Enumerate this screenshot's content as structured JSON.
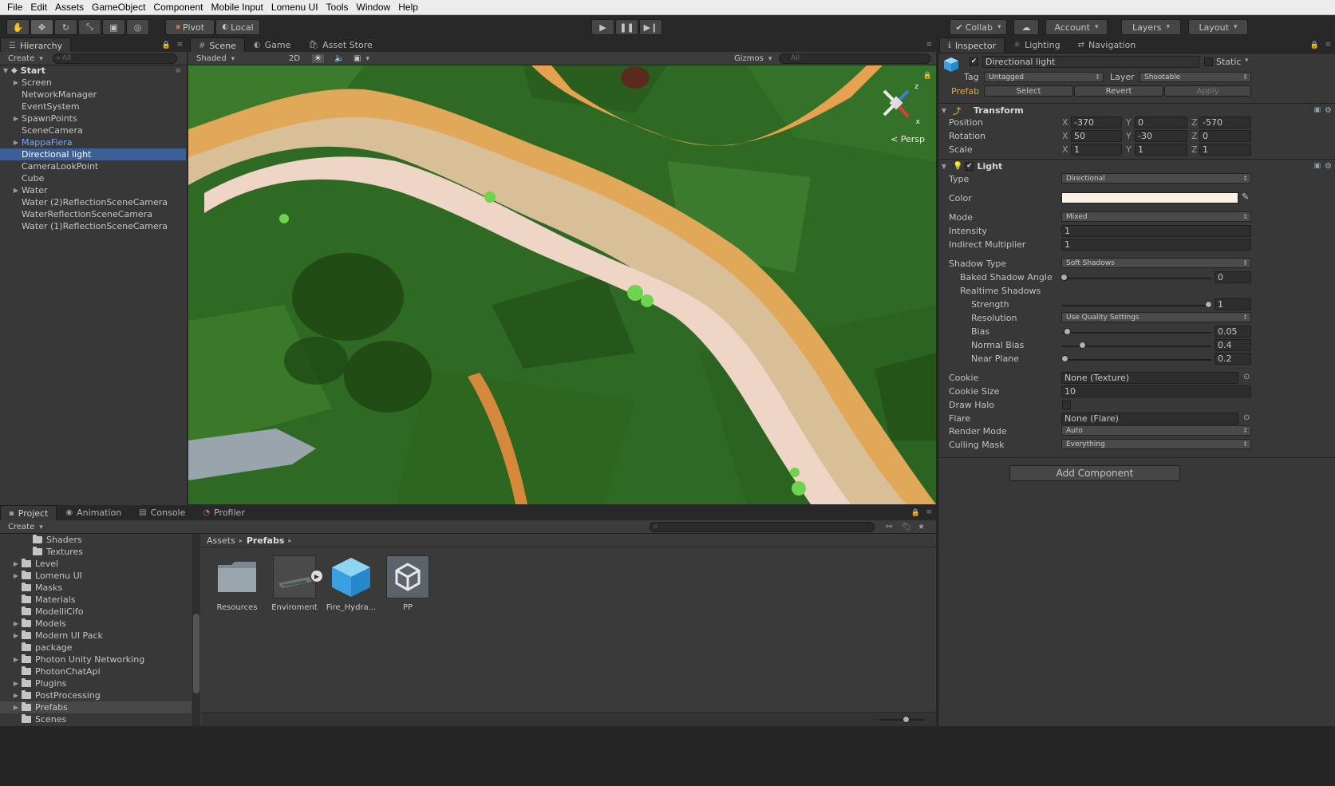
{
  "menu": [
    "File",
    "Edit",
    "Assets",
    "GameObject",
    "Component",
    "Mobile Input",
    "Lomenu UI",
    "Tools",
    "Window",
    "Help"
  ],
  "toolbar": {
    "pivot": "Pivot",
    "local": "Local",
    "collab": "Collab",
    "account": "Account",
    "layers": "Layers",
    "layout": "Layout"
  },
  "hierarchy": {
    "tab": "Hierarchy",
    "create": "Create",
    "search_placeholder": "All",
    "scene": "Start",
    "items": [
      "Screen",
      "NetworkManager",
      "EventSystem",
      "SpawnPoints",
      "SceneCamera",
      "MappaFiera",
      "Directional light",
      "CameraLookPoint",
      "Cube",
      "Water",
      "Water (2)ReflectionSceneCamera",
      "WaterReflectionSceneCamera",
      "Water (1)ReflectionSceneCamera"
    ],
    "selected": "Directional light"
  },
  "scene": {
    "tabs": [
      "Scene",
      "Game",
      "Asset Store"
    ],
    "shading": "Shaded",
    "mode2d": "2D",
    "gizmos": "Gizmos",
    "search_placeholder": "All",
    "persp": "Persp",
    "axis": {
      "x": "x",
      "y": "y",
      "z": "z"
    }
  },
  "inspector": {
    "tabs": [
      "Inspector",
      "Lighting",
      "Navigation"
    ],
    "object_name": "Directional light",
    "static": "Static",
    "tag_label": "Tag",
    "tag": "Untagged",
    "layer_label": "Layer",
    "layer": "Shootable",
    "prefab_label": "Prefab",
    "select": "Select",
    "revert": "Revert",
    "apply": "Apply",
    "transform": {
      "title": "Transform",
      "position": {
        "label": "Position",
        "x": "-370",
        "y": "0",
        "z": "-570"
      },
      "rotation": {
        "label": "Rotation",
        "x": "50",
        "y": "-30",
        "z": "0"
      },
      "scale": {
        "label": "Scale",
        "x": "1",
        "y": "1",
        "z": "1"
      }
    },
    "light": {
      "title": "Light",
      "type_label": "Type",
      "type": "Directional",
      "color_label": "Color",
      "color": "#fdf2e3",
      "mode_label": "Mode",
      "mode": "Mixed",
      "intensity_label": "Intensity",
      "intensity": "1",
      "indirect_label": "Indirect Multiplier",
      "indirect": "1",
      "shadow_type_label": "Shadow Type",
      "shadow_type": "Soft Shadows",
      "baked_angle_label": "Baked Shadow Angle",
      "baked_angle": "0",
      "realtime_label": "Realtime Shadows",
      "strength_label": "Strength",
      "strength": "1",
      "resolution_label": "Resolution",
      "resolution": "Use Quality Settings",
      "bias_label": "Bias",
      "bias": "0.05",
      "normal_bias_label": "Normal Bias",
      "normal_bias": "0.4",
      "near_plane_label": "Near Plane",
      "near_plane": "0.2",
      "cookie_label": "Cookie",
      "cookie": "None (Texture)",
      "cookie_size_label": "Cookie Size",
      "cookie_size": "10",
      "draw_halo_label": "Draw Halo",
      "flare_label": "Flare",
      "flare": "None (Flare)",
      "render_mode_label": "Render Mode",
      "render_mode": "Auto",
      "culling_label": "Culling Mask",
      "culling": "Everything"
    },
    "add_component": "Add Component"
  },
  "project": {
    "tabs": [
      "Project",
      "Animation",
      "Console",
      "Profiler"
    ],
    "create": "Create",
    "folders": [
      {
        "name": "Shaders",
        "indent": 1,
        "arrow": false
      },
      {
        "name": "Textures",
        "indent": 1,
        "arrow": false
      },
      {
        "name": "Level",
        "indent": 0,
        "arrow": true
      },
      {
        "name": "Lomenu UI",
        "indent": 0,
        "arrow": true
      },
      {
        "name": "Masks",
        "indent": 0,
        "arrow": false
      },
      {
        "name": "Materials",
        "indent": 0,
        "arrow": false
      },
      {
        "name": "ModelliCifo",
        "indent": 0,
        "arrow": false
      },
      {
        "name": "Models",
        "indent": 0,
        "arrow": true
      },
      {
        "name": "Modern UI Pack",
        "indent": 0,
        "arrow": true
      },
      {
        "name": "package",
        "indent": 0,
        "arrow": false
      },
      {
        "name": "Photon Unity Networking",
        "indent": 0,
        "arrow": true
      },
      {
        "name": "PhotonChatApi",
        "indent": 0,
        "arrow": false
      },
      {
        "name": "Plugins",
        "indent": 0,
        "arrow": true
      },
      {
        "name": "PostProcessing",
        "indent": 0,
        "arrow": true
      },
      {
        "name": "Prefabs",
        "indent": 0,
        "arrow": true
      },
      {
        "name": "Scenes",
        "indent": 0,
        "arrow": false
      }
    ],
    "selected_folder": "Prefabs",
    "breadcrumb": [
      "Assets",
      "Prefabs"
    ],
    "assets": [
      "Resources",
      "Enviroment",
      "Fire_Hydra...",
      "PP"
    ]
  }
}
